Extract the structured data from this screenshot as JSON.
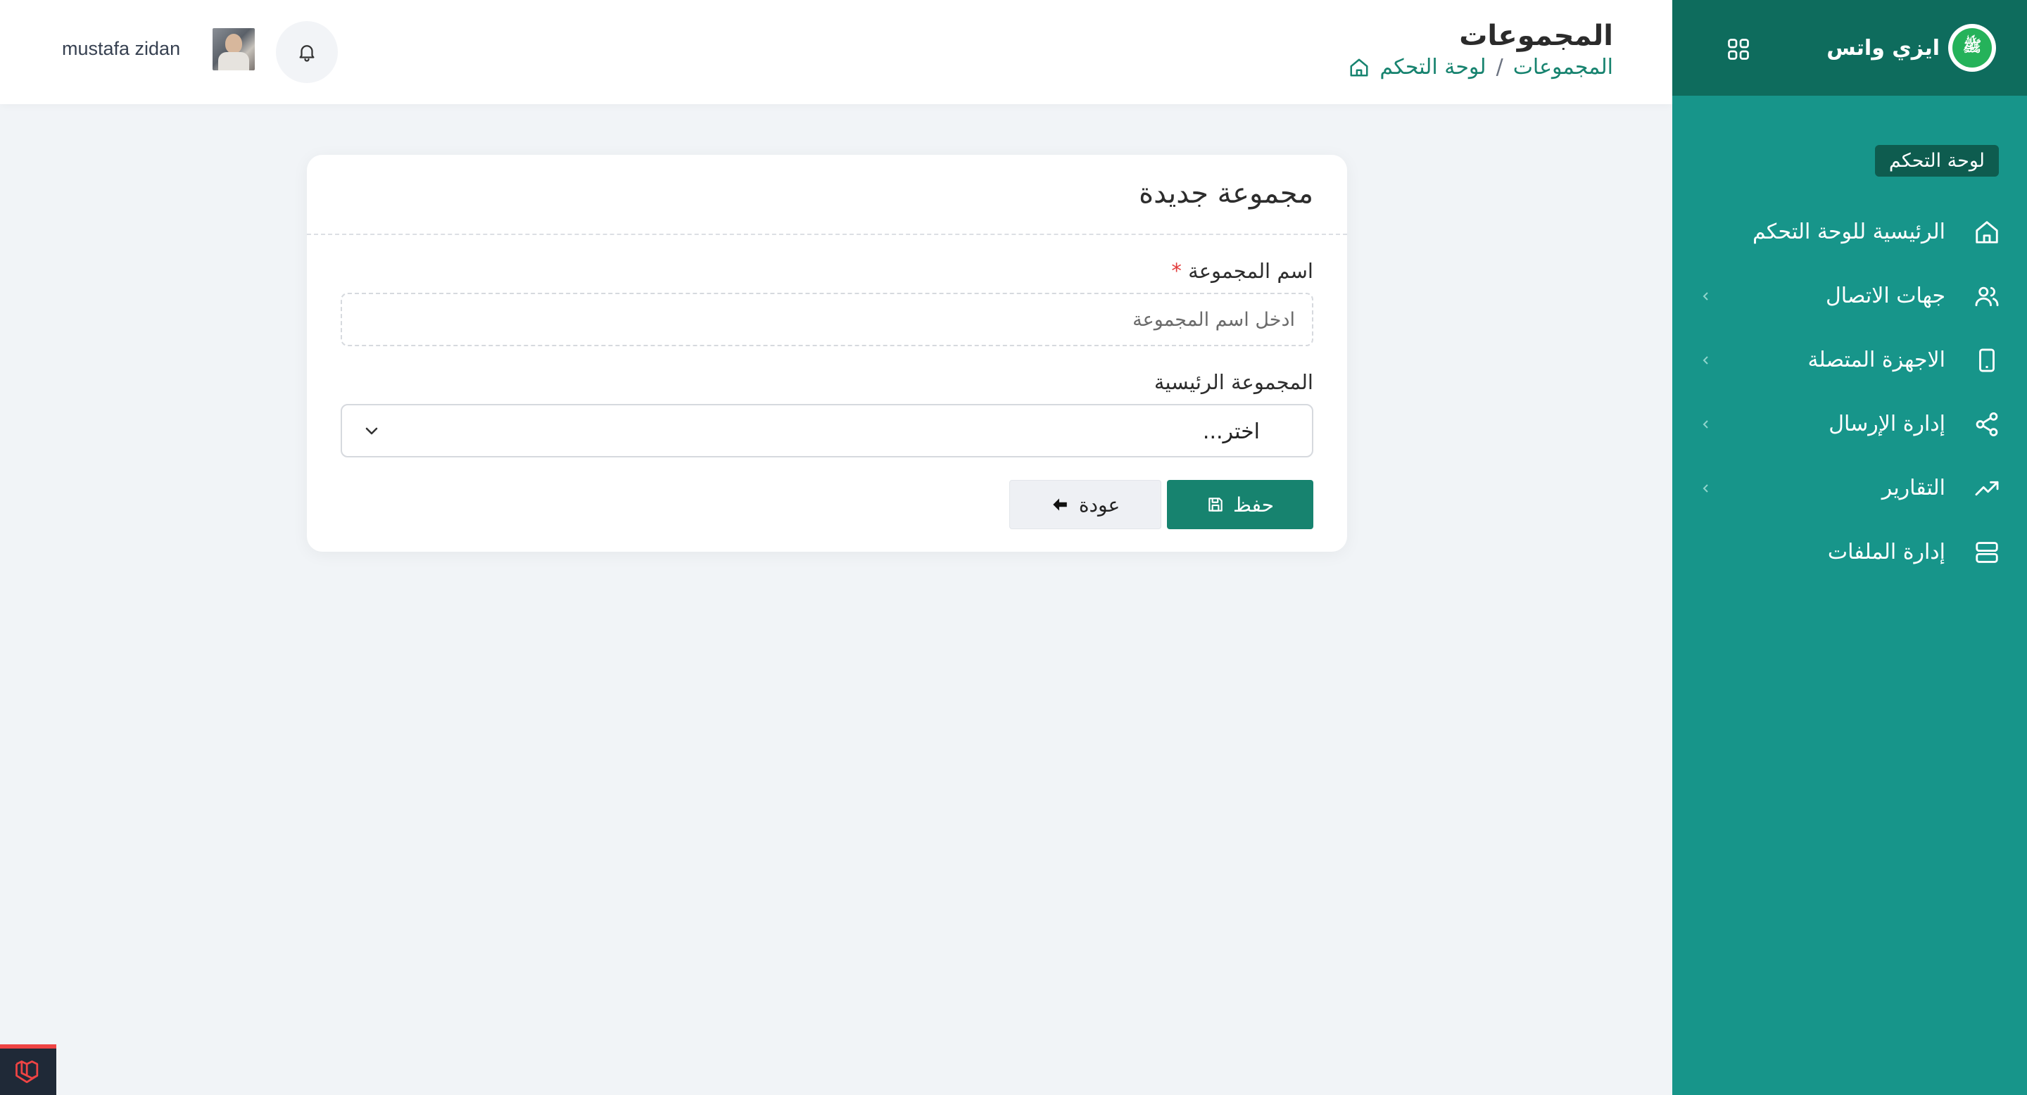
{
  "sidebar": {
    "brand": {
      "name": "ايزي واتس",
      "logo_text": "ﷺ"
    },
    "section_label": "لوحة التحكم",
    "items": [
      {
        "label": "الرئيسية للوحة التحكم",
        "icon": "home-icon",
        "has_submenu": false
      },
      {
        "label": "جهات الاتصال",
        "icon": "users-icon",
        "has_submenu": true
      },
      {
        "label": "الاجهزة المتصلة",
        "icon": "device-icon",
        "has_submenu": true
      },
      {
        "label": "إدارة الإرسال",
        "icon": "share-icon",
        "has_submenu": true
      },
      {
        "label": "التقارير",
        "icon": "trend-icon",
        "has_submenu": true
      },
      {
        "label": "إدارة الملفات",
        "icon": "server-icon",
        "has_submenu": false
      }
    ]
  },
  "header": {
    "title": "المجموعات",
    "breadcrumb": {
      "home": "لوحة التحكم",
      "separator": "/",
      "current": "المجموعات"
    },
    "user": {
      "name": "mustafa zidan"
    }
  },
  "form": {
    "title": "مجموعة جديدة",
    "name_label": "اسم المجموعة",
    "required_mark": "*",
    "name_placeholder": "ادخل اسم المجموعة",
    "parent_label": "المجموعة الرئيسية",
    "parent_selected": "اختر...",
    "save_label": "حفظ",
    "back_label": "عودة"
  },
  "colors": {
    "sidebar": "#17958a",
    "sidebar_top": "#0e6c5d",
    "primary": "#17836f",
    "background": "#f1f4f7"
  }
}
